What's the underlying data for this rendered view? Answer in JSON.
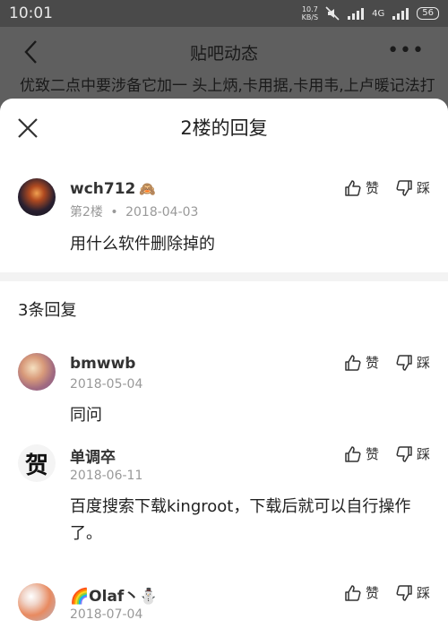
{
  "statusbar": {
    "time": "10:01",
    "speed_top": "10.7",
    "speed_bottom": "KB/S",
    "net": "4G",
    "battery": "56"
  },
  "page": {
    "title": "贴吧动态",
    "more_label": "•••",
    "bg_text": "优致二点中要涉备它加一 头上炳,卡用据,卡用韦,上卢暖记法打当"
  },
  "sheet": {
    "title": "2楼的回复"
  },
  "floor": {
    "user": "wch712",
    "badge": "🙈",
    "floor": "第2楼",
    "dot": "•",
    "date": "2018-04-03",
    "text": "用什么软件删除掉的",
    "like": "赞",
    "dislike": "踩"
  },
  "reply_count": "3条回复",
  "replies": [
    {
      "user": "bmwwb",
      "date": "2018-05-04",
      "text": "同问",
      "like": "赞",
      "dislike": "踩"
    },
    {
      "user": "单调卒",
      "avatar_char": "贺",
      "date": "2018-06-11",
      "text": "百度搜索下载kingroot，下载后就可以自行操作了。",
      "like": "赞",
      "dislike": "踩"
    },
    {
      "user": "🌈Olaf丶⛄",
      "date": "2018-07-04",
      "like": "赞",
      "dislike": "踩"
    }
  ]
}
